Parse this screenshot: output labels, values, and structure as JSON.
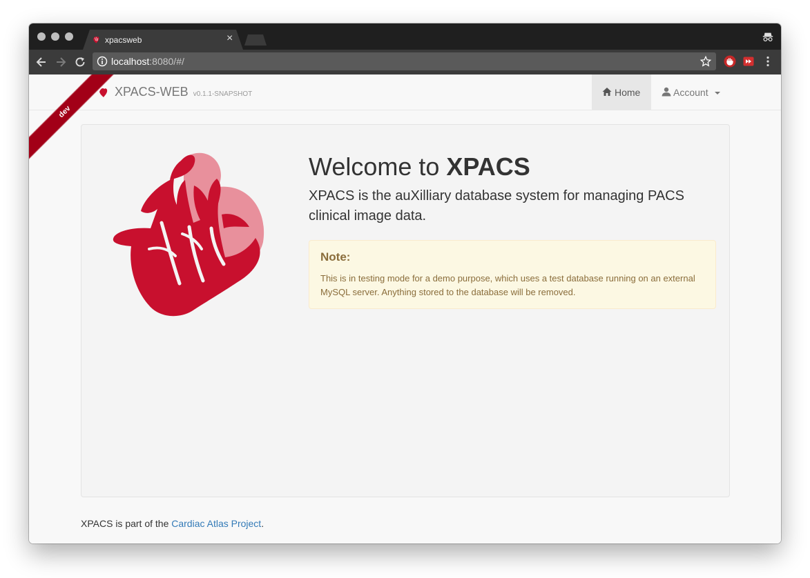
{
  "browser": {
    "tab_title": "xpacsweb",
    "tab_close": "×",
    "url_host": "localhost",
    "url_rest": ":8080/#/"
  },
  "navbar": {
    "brand": "XPACS-WEB",
    "version": "v0.1.1-SNAPSHOT",
    "home_label": "Home",
    "account_label": "Account",
    "ribbon": "dev"
  },
  "main": {
    "title_prefix": "Welcome to ",
    "title_bold": "XPACS",
    "lead": "XPACS is the auXilliary database system for managing PACS clinical image data.",
    "note_title": "Note:",
    "note_text": "This is in testing mode for a demo purpose, which uses a test database running on an external MySQL server. Anything stored to the database will be removed."
  },
  "footer": {
    "prefix": "XPACS is part of the ",
    "link": "Cardiac Atlas Project",
    "suffix": "."
  },
  "colors": {
    "brand_red": "#c8102e",
    "ribbon": "#a20017",
    "link": "#337ab7",
    "alert_bg": "#fcf8e3",
    "alert_text": "#8a6d3b"
  },
  "icons": [
    "heart-logo-icon",
    "close-icon",
    "incognito-icon",
    "back-icon",
    "forward-icon",
    "reload-icon",
    "info-icon",
    "star-icon",
    "extension-icon",
    "menu-icon",
    "home-icon",
    "user-icon",
    "caret-down-icon"
  ]
}
